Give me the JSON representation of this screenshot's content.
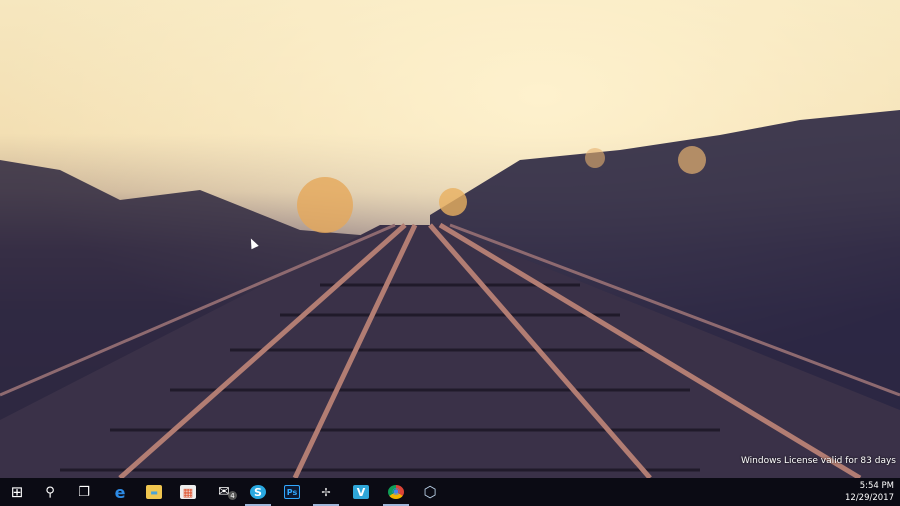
{
  "desktop": {
    "license_text": "Windows License valid for 83 days"
  },
  "taskbar": {
    "items": [
      {
        "name": "start",
        "glyph": "⊞"
      },
      {
        "name": "search",
        "glyph": "⚲"
      },
      {
        "name": "task-view",
        "glyph": "❐"
      },
      {
        "name": "edge",
        "glyph": "e"
      },
      {
        "name": "file-explorer",
        "glyph": "▬"
      },
      {
        "name": "store",
        "glyph": "▦"
      },
      {
        "name": "mail",
        "glyph": "✉",
        "badge": "4"
      },
      {
        "name": "skype",
        "glyph": "S"
      },
      {
        "name": "photoshop",
        "glyph": "Ps"
      },
      {
        "name": "pinwheel-app",
        "glyph": "✢"
      },
      {
        "name": "kinemaster-app",
        "glyph": "V"
      },
      {
        "name": "chrome",
        "glyph": "◉"
      },
      {
        "name": "virtualbox",
        "glyph": "⬡"
      }
    ],
    "time": "5:54 PM",
    "date": "12/29/2017"
  },
  "colors": {
    "taskbar": "#0b0b14",
    "accent": "#9fb6d9"
  }
}
